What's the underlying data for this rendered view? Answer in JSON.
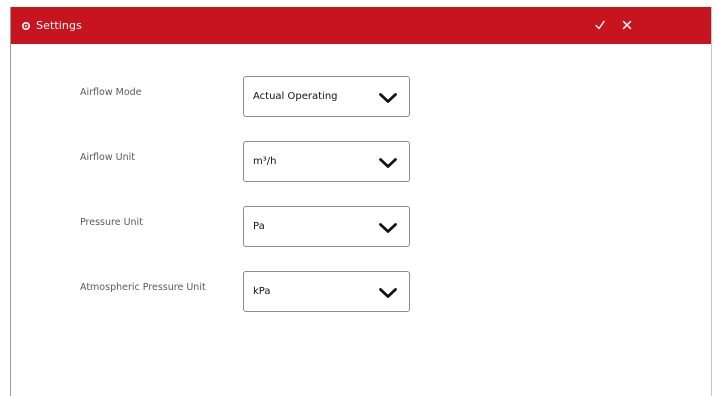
{
  "window": {
    "title": "Settings",
    "title_icon": "gear-icon",
    "accent_color": "#c8141e",
    "actions": {
      "confirm_icon": "checkmark-icon",
      "close_icon": "close-icon"
    }
  },
  "settings": [
    {
      "label": "Airflow Mode",
      "value": "Actual Operating"
    },
    {
      "label": "Airflow Unit",
      "value": "m³/h"
    },
    {
      "label": "Pressure Unit",
      "value": "Pa"
    },
    {
      "label": "Atmospheric Pressure Unit",
      "value": "kPa"
    }
  ]
}
